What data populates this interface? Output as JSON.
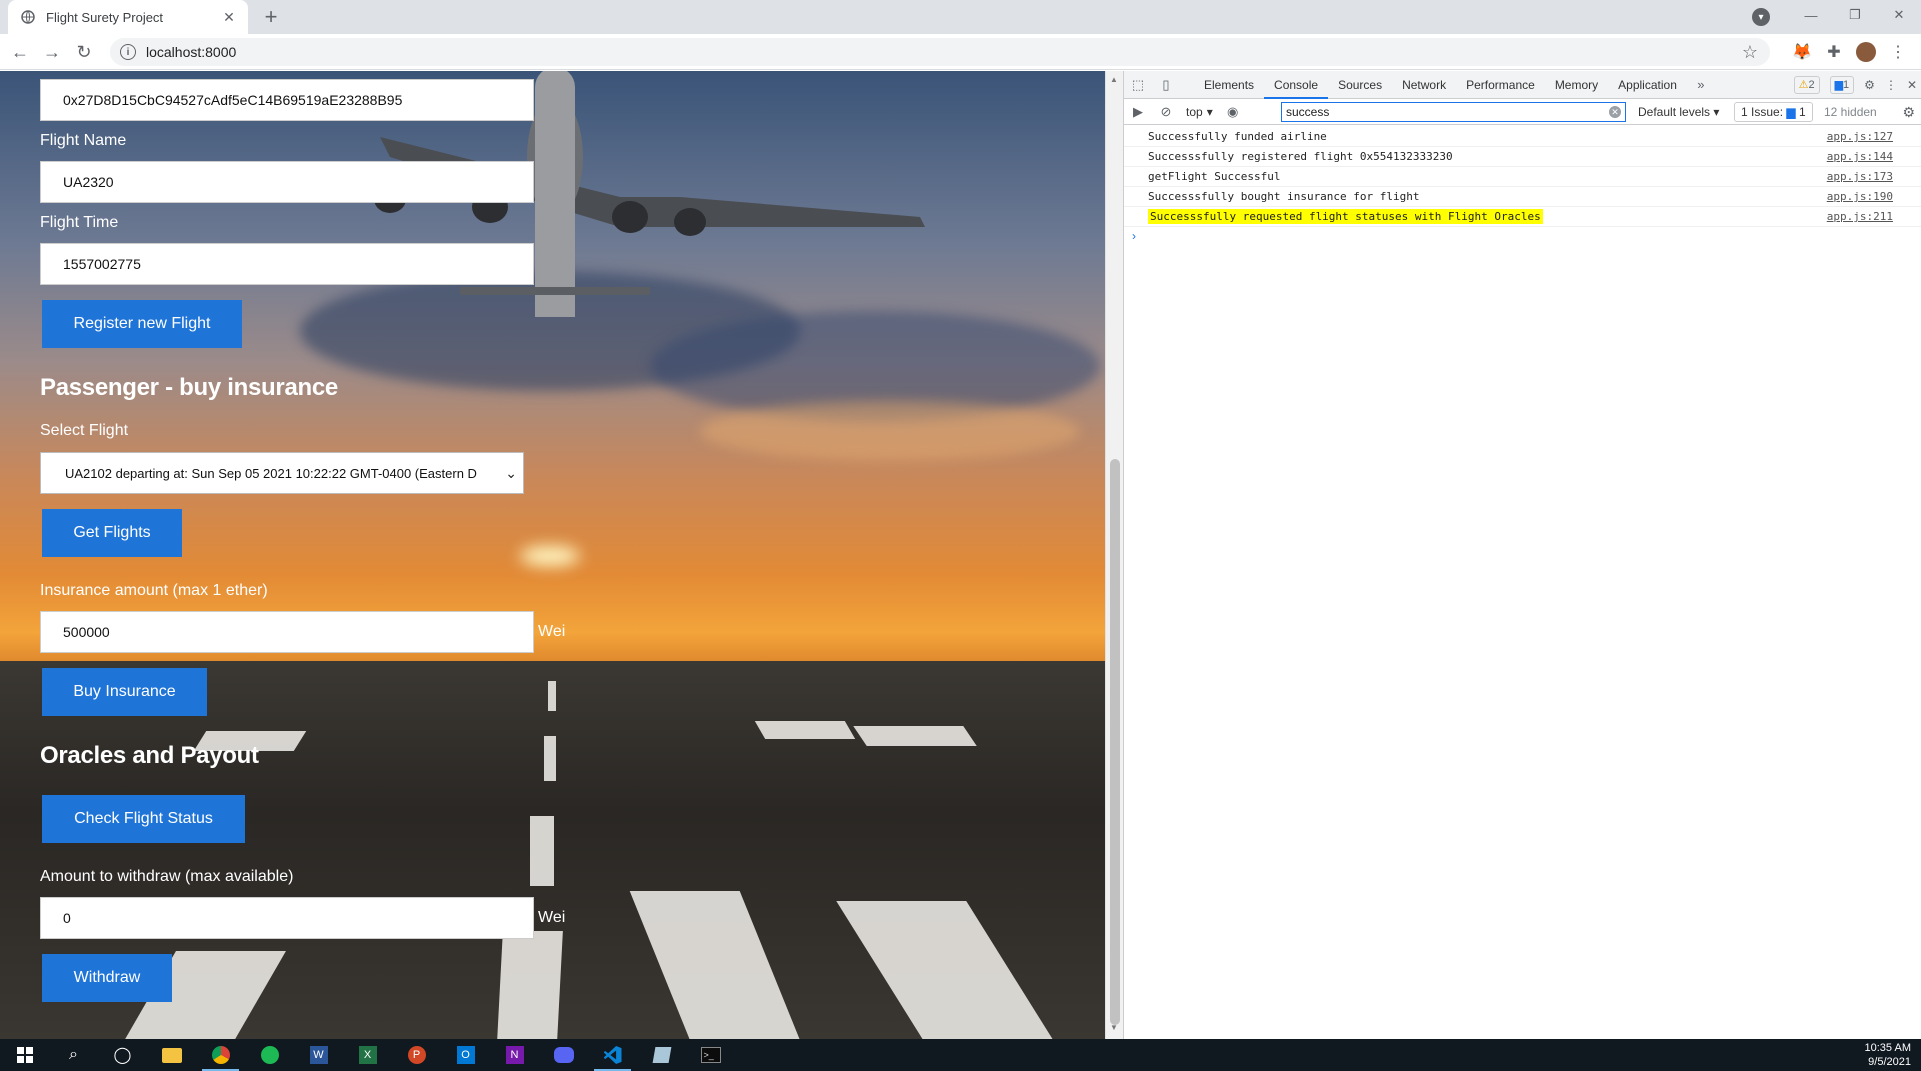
{
  "browser": {
    "tab_title": "Flight Surety Project",
    "url": "localhost:8000"
  },
  "form": {
    "airline_address_value": "0x27D8D15CbC94527cAdf5eC14B69519aE23288B95",
    "flight_name_label": "Flight Name",
    "flight_name_value": "UA2320",
    "flight_time_label": "Flight Time",
    "flight_time_value": "1557002775",
    "register_button": "Register new Flight",
    "passenger_heading": "Passenger - buy insurance",
    "select_flight_label": "Select Flight",
    "select_flight_value": "UA2102 departing at: Sun Sep 05 2021 10:22:22 GMT-0400 (Eastern D",
    "get_flights_button": "Get Flights",
    "insurance_label": "Insurance amount (max 1 ether)",
    "insurance_value": "500000",
    "insurance_unit": "Wei",
    "buy_button": "Buy Insurance",
    "oracles_heading": "Oracles and Payout",
    "check_status_button": "Check Flight Status",
    "withdraw_label": "Amount to withdraw (max available)",
    "withdraw_value": "0",
    "withdraw_unit": "Wei",
    "withdraw_button": "Withdraw"
  },
  "devtools": {
    "tabs": [
      "Elements",
      "Console",
      "Sources",
      "Network",
      "Performance",
      "Memory",
      "Application"
    ],
    "warnings_count": "2",
    "messages_count": "1",
    "context": "top",
    "filter_value": "success",
    "levels": "Default levels",
    "issues": "1 Issue:",
    "issues_count": "1",
    "hidden": "12 hidden",
    "logs": [
      {
        "msg": "Successfully funded airline",
        "src": "app.js:127"
      },
      {
        "msg": "Successsfully registered flight 0x554132333230",
        "src": "app.js:144"
      },
      {
        "msg": "getFlight Successful",
        "src": "app.js:173"
      },
      {
        "msg": "Successsfully bought insurance for flight",
        "src": "app.js:190"
      },
      {
        "msg": "Successsfully requested flight statuses with Flight Oracles",
        "src": "app.js:211"
      }
    ],
    "prompt": "›"
  },
  "taskbar": {
    "time": "10:35 AM",
    "date": "9/5/2021"
  },
  "colors": {
    "button_blue": "#1f74d8",
    "highlight": "#ffff00"
  }
}
